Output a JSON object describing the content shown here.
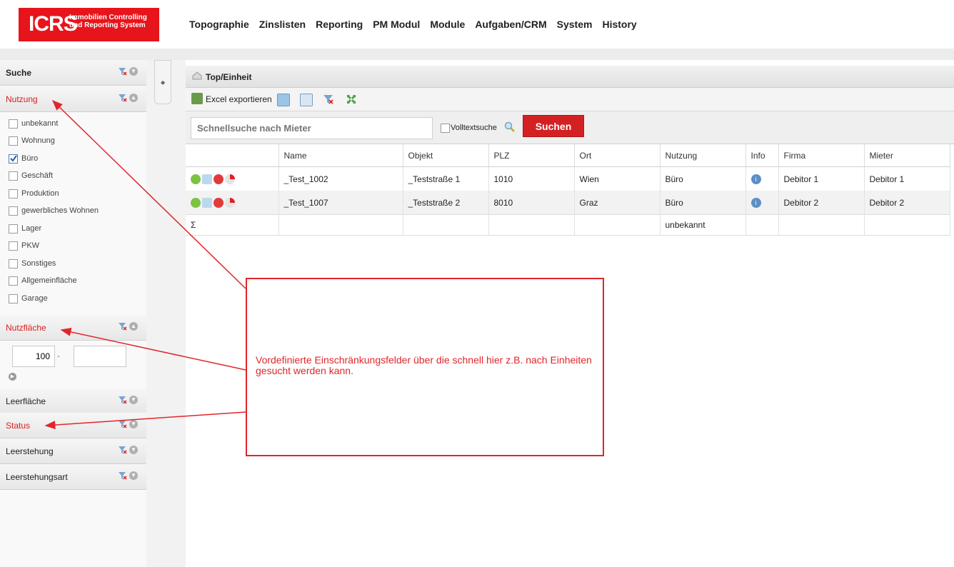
{
  "logo": {
    "brand": "ICRS",
    "tagline_1": "Immobilien Controlling",
    "tagline_2": "und Reporting System",
    "color": "#e8141b"
  },
  "menu": [
    "Topographie",
    "Zinslisten",
    "Reporting",
    "PM Modul",
    "Module",
    "Aufgaben/CRM",
    "System",
    "History"
  ],
  "sidebar": {
    "search_title": "Suche",
    "nutzung": {
      "title": "Nutzung",
      "options": [
        {
          "label": "unbekannt",
          "checked": false
        },
        {
          "label": "Wohnung",
          "checked": false
        },
        {
          "label": "Büro",
          "checked": true
        },
        {
          "label": "Geschäft",
          "checked": false
        },
        {
          "label": "Produktion",
          "checked": false
        },
        {
          "label": "gewerbliches Wohnen",
          "checked": false
        },
        {
          "label": "Lager",
          "checked": false
        },
        {
          "label": "PKW",
          "checked": false
        },
        {
          "label": "Sonstiges",
          "checked": false
        },
        {
          "label": "Allgemeinfläche",
          "checked": false
        },
        {
          "label": "Garage",
          "checked": false
        }
      ]
    },
    "nutzflaeche": {
      "title": "Nutzfläche",
      "from_value": "100",
      "separator": "-",
      "to_value": ""
    },
    "sections": [
      "Leerfläche",
      "Status",
      "Leerstehung",
      "Leerstehungsart"
    ]
  },
  "main": {
    "breadcrumb": "Top/Einheit",
    "toolbar": {
      "export_label": "Excel exportieren"
    },
    "search": {
      "placeholder": "Schnellsuche nach Mieter",
      "fulltext_label": "Volltextsuche",
      "button_label": "Suchen"
    },
    "table": {
      "columns": [
        "",
        "Name",
        "Objekt",
        "PLZ",
        "Ort",
        "Nutzung",
        "Info",
        "Firma",
        "Mieter"
      ],
      "rows": [
        {
          "name": "_Test_1002",
          "objekt": "_Teststraße 1",
          "plz": "1010",
          "ort": "Wien",
          "nutzung": "Büro",
          "firma": "Debitor 1",
          "mieter": "Debitor 1"
        },
        {
          "name": "_Test_1007",
          "objekt": "_Teststraße 2",
          "plz": "8010",
          "ort": "Graz",
          "nutzung": "Büro",
          "firma": "Debitor 2",
          "mieter": "Debitor 2"
        }
      ],
      "sum_row": {
        "symbol": "Σ",
        "nutzung": "unbekannt"
      }
    }
  },
  "annotation": {
    "text": "Vordefinierte Einschränkungsfelder über die schnell hier z.B. nach Einheiten gesucht werden kann.",
    "color": "#e0262b"
  }
}
